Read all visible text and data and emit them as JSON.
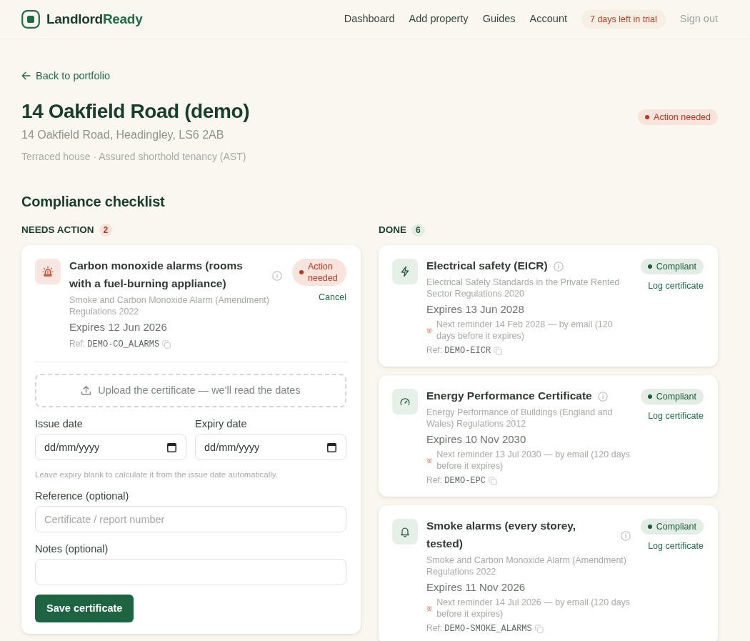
{
  "header": {
    "brand": [
      {
        "text": "Landlord",
        "kind": "base"
      },
      {
        "text": "Ready",
        "kind": "accent"
      }
    ],
    "nav": [
      {
        "label": "Dashboard",
        "kind": "link"
      },
      {
        "label": "Add property",
        "kind": "link"
      },
      {
        "label": "Guides",
        "kind": "link"
      },
      {
        "label": "Account",
        "kind": "link"
      },
      {
        "label": "7 days left in trial",
        "kind": "trial"
      },
      {
        "label": "Sign out",
        "kind": "muted"
      }
    ]
  },
  "back_link": {
    "label": "Back to portfolio"
  },
  "property": {
    "title": "14 Oakfield Road (demo)",
    "address": "14 Oakfield Road, Headingley, LS6 2AB",
    "details": "Terraced house · Assured shorthold tenancy (AST)",
    "status": {
      "label": "Action needed",
      "kind": "action"
    }
  },
  "checklist": {
    "title": "Compliance checklist",
    "columns": [
      {
        "heading": "NEEDS ACTION",
        "count": "2",
        "kind": "action",
        "items": [
          {
            "title": "Carbon monoxide alarms (rooms with a fuel-burning appliance)",
            "regulation": "Smoke and Carbon Monoxide Alarm (Amendment) Regulations 2022",
            "expires": "Expires 12 Jun 2026",
            "ref_label": "Ref:",
            "ref": "DEMO-CO_ALARMS",
            "status": {
              "label": "Action needed",
              "kind": "action"
            },
            "link": "Cancel",
            "form": {
              "upload": "Upload the certificate — we'll read the dates",
              "date_fields": [
                {
                  "label": "Issue date",
                  "placeholder": "dd/mm/yyyy"
                },
                {
                  "label": "Expiry date",
                  "placeholder": "dd/mm/yyyy"
                }
              ],
              "hint": "Leave expiry blank to calculate it from the issue date automatically.",
              "fields": [
                {
                  "label": "Reference (optional)",
                  "placeholder": "Certificate / report number"
                },
                {
                  "label": "Notes (optional)"
                }
              ],
              "submit": "Save certificate"
            }
          }
        ]
      },
      {
        "heading": "DONE",
        "count": "6",
        "kind": "done",
        "items": [
          {
            "title": "Electrical safety (EICR)",
            "regulation": "Electrical Safety Standards in the Private Rented Sector Regulations 2020",
            "expires": "Expires 13 Jun 2028",
            "reminder": "Next reminder 14 Feb 2028 — by email (120 days before it expires)",
            "ref_label": "Ref:",
            "ref": "DEMO-EICR",
            "status": {
              "label": "Compliant",
              "kind": "compliant"
            },
            "link": "Log certificate"
          },
          {
            "title": "Energy Performance Certificate",
            "regulation": "Energy Performance of Buildings (England and Wales) Regulations 2012",
            "expires": "Expires 10 Nov 2030",
            "reminder": "Next reminder 13 Jul 2030 — by email (120 days before it expires)",
            "ref_label": "Ref:",
            "ref": "DEMO-EPC",
            "status": {
              "label": "Compliant",
              "kind": "compliant"
            },
            "link": "Log certificate"
          },
          {
            "title": "Smoke alarms (every storey, tested)",
            "regulation": "Smoke and Carbon Monoxide Alarm (Amendment) Regulations 2022",
            "expires": "Expires 11 Nov 2026",
            "reminder": "Next reminder 14 Jul 2026 — by email (120 days before it expires)",
            "ref_label": "Ref:",
            "ref": "DEMO-SMOKE_ALARMS",
            "status": {
              "label": "Compliant",
              "kind": "compliant"
            },
            "link": "Log certificate"
          }
        ]
      }
    ]
  }
}
